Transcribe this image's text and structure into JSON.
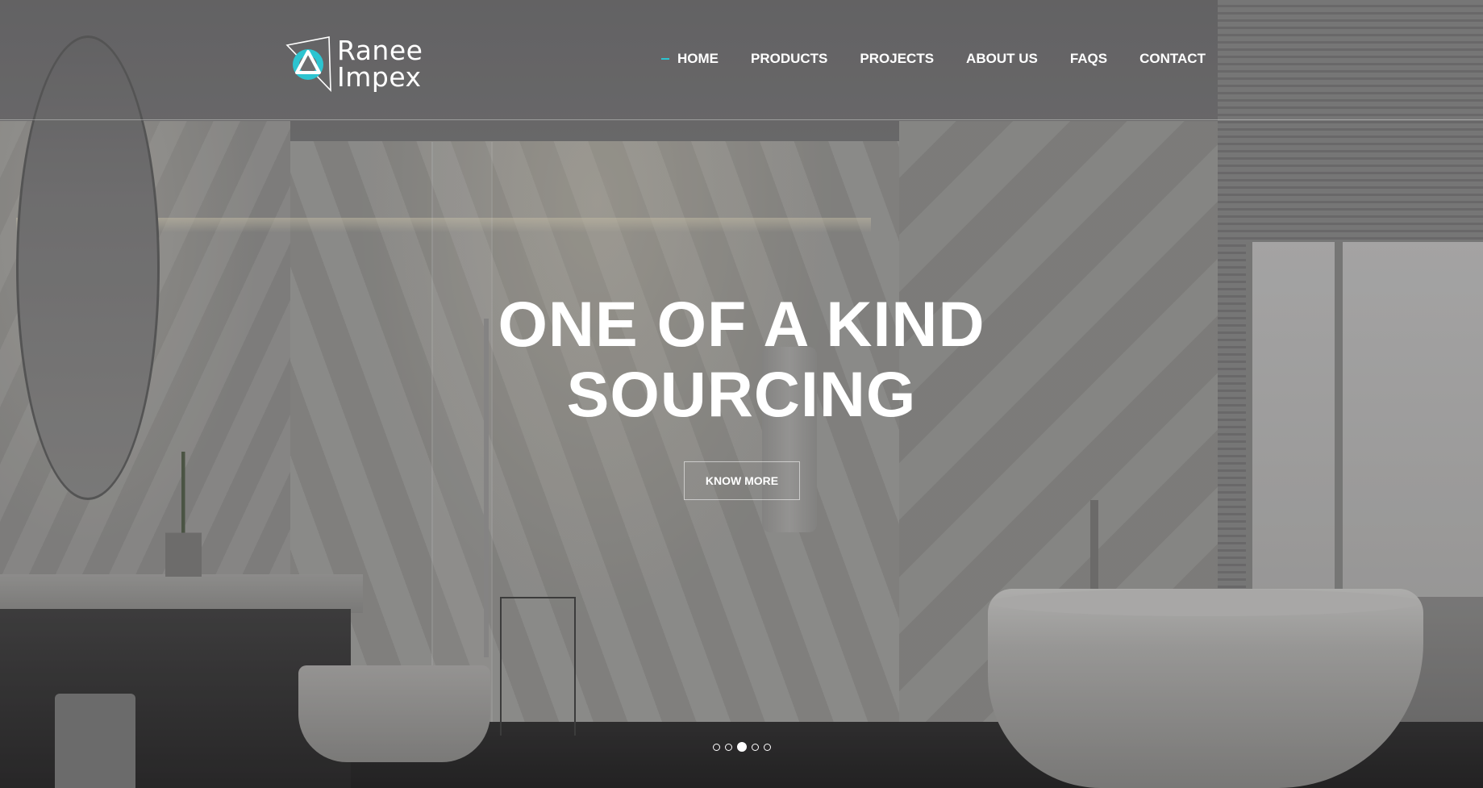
{
  "brand": {
    "name_line1": "Ranee",
    "name_line2": "Impex",
    "accent_color": "#2cc4d0"
  },
  "nav": {
    "items": [
      {
        "label": "HOME",
        "active": true
      },
      {
        "label": "PRODUCTS"
      },
      {
        "label": "PROJECTS"
      },
      {
        "label": "ABOUT US"
      },
      {
        "label": "FAQS"
      },
      {
        "label": "CONTACT"
      }
    ]
  },
  "hero": {
    "title_line1": "ONE OF A KIND",
    "title_line2": "SOURCING",
    "cta_label": "KNOW MORE"
  },
  "slider": {
    "slide_count": 5,
    "active_slide": 3
  }
}
